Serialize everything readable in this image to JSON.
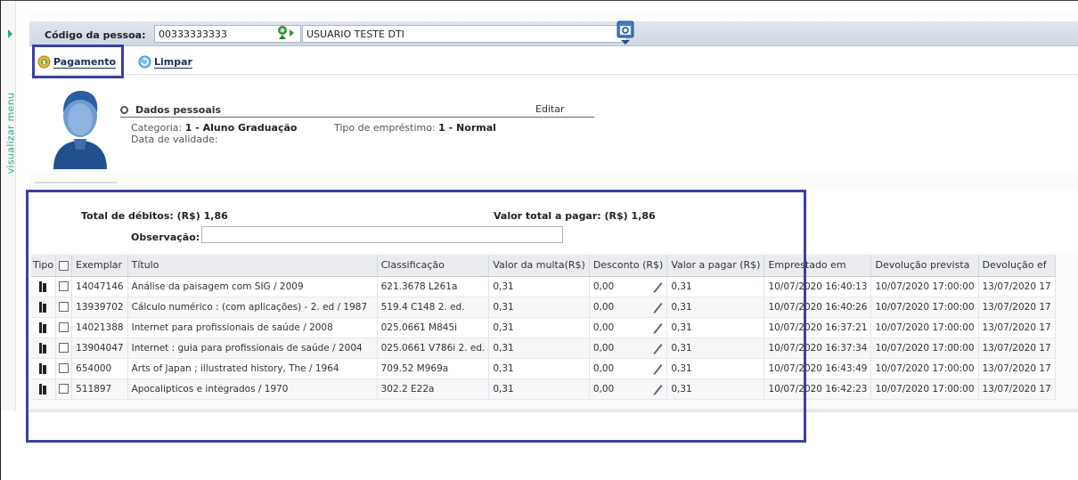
{
  "side_menu": {
    "label": "visualizar menu"
  },
  "header": {
    "codigo_label": "Código da pessoa:",
    "codigo_value": "00333333333",
    "nome_value": "USUARIO TESTE DTI"
  },
  "toolbar": {
    "pagamento_label": "Pagamento",
    "limpar_label": "Limpar"
  },
  "profile": {
    "dados_title": "Dados pessoais",
    "editar_label": "Editar",
    "categoria_label": "Categoria:",
    "categoria_value": "1 - Aluno Graduação",
    "tipo_label": "Tipo de empréstimo:",
    "tipo_value": "1 - Normal",
    "validade_label": "Data de validade:"
  },
  "summary": {
    "total_debitos": "Total de débitos: (R$) 1,86",
    "valor_total": "Valor total a pagar: (R$) 1,86",
    "observacao_label": "Observação:"
  },
  "grid": {
    "headers": {
      "tipo": "Tipo",
      "exemplar": "Exemplar",
      "titulo": "Título",
      "classificacao": "Classificação",
      "valor_multa": "Valor da multa(R$)",
      "desconto": "Desconto (R$)",
      "valor_pagar": "Valor a pagar (R$)",
      "emprestado": "Emprestado em",
      "devolucao_prevista": "Devolução prevista",
      "devolucao_efetiva": "Devolução ef"
    },
    "rows": [
      {
        "exemplar": "14047146",
        "titulo": "Análise da paisagem com SIG / 2009",
        "classificacao": "621.3678 L261a",
        "multa": "0,31",
        "desconto": "0,00",
        "pagar": "0,31",
        "emprestado": "10/07/2020 16:40:13",
        "prevista": "10/07/2020 17:00:00",
        "efetiva": "13/07/2020 17"
      },
      {
        "exemplar": "13939702",
        "titulo": "Cálculo numérico : (com aplicações) - 2. ed / 1987",
        "classificacao": "519.4 C148 2. ed.",
        "multa": "0,31",
        "desconto": "0,00",
        "pagar": "0,31",
        "emprestado": "10/07/2020 16:40:26",
        "prevista": "10/07/2020 17:00:00",
        "efetiva": "13/07/2020 17"
      },
      {
        "exemplar": "14021388",
        "titulo": "Internet para profissionais de saúde / 2008",
        "classificacao": "025.0661 M845i",
        "multa": "0,31",
        "desconto": "0,00",
        "pagar": "0,31",
        "emprestado": "10/07/2020 16:37:21",
        "prevista": "10/07/2020 17:00:00",
        "efetiva": "13/07/2020 17"
      },
      {
        "exemplar": "13904047",
        "titulo": "Internet : guia para profissionais de saúde / 2004",
        "classificacao": "025.0661 V786i 2. ed.",
        "multa": "0,31",
        "desconto": "0,00",
        "pagar": "0,31",
        "emprestado": "10/07/2020 16:37:34",
        "prevista": "10/07/2020 17:00:00",
        "efetiva": "13/07/2020 17"
      },
      {
        "exemplar": "654000",
        "titulo": "Arts of Japan ; illustrated history, The / 1964",
        "classificacao": "709.52 M969a",
        "multa": "0,31",
        "desconto": "0,00",
        "pagar": "0,31",
        "emprestado": "10/07/2020 16:43:49",
        "prevista": "10/07/2020 17:00:00",
        "efetiva": "13/07/2020 17"
      },
      {
        "exemplar": "511897",
        "titulo": "Apocalipticos e integrados / 1970",
        "classificacao": "302.2 E22a",
        "multa": "0,31",
        "desconto": "0,00",
        "pagar": "0,31",
        "emprestado": "10/07/2020 16:42:23",
        "prevista": "10/07/2020 17:00:00",
        "efetiva": "13/07/2020 17"
      }
    ]
  },
  "colors": {
    "accent_green": "#2aa68a",
    "highlight_border": "#3c3fa0",
    "link_navy": "#1a2f5a"
  },
  "icons": [
    "arrow-right-icon",
    "person-search-icon",
    "calendar-icon",
    "coins-icon",
    "refresh-icon",
    "avatar-icon",
    "book-icon",
    "pencil-icon"
  ]
}
